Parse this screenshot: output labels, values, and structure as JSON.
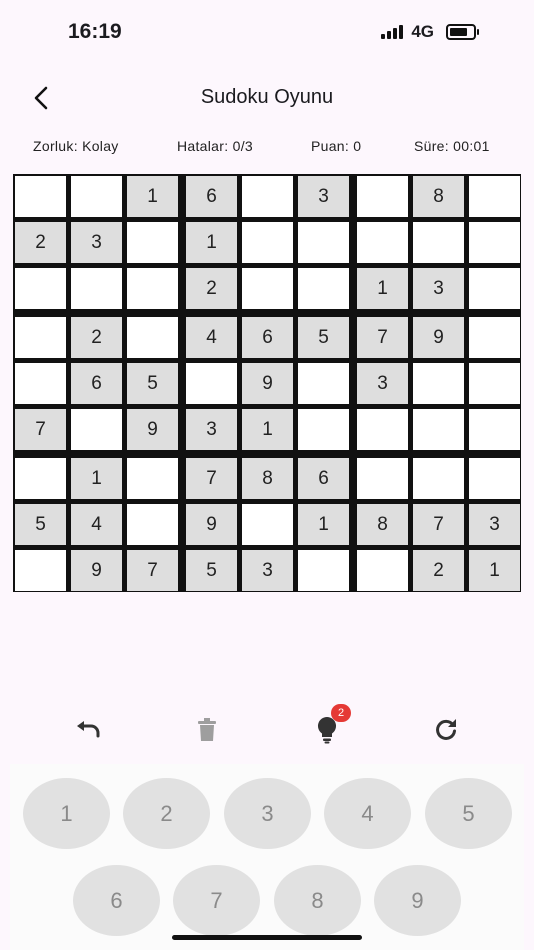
{
  "status_bar": {
    "time": "16:19",
    "network": "4G",
    "battery_level": 0.85
  },
  "header": {
    "title": "Sudoku Oyunu",
    "back_icon": "chevron-left-icon"
  },
  "info": {
    "difficulty": "Zorluk: Kolay",
    "mistakes": "Hatalar: 0/3",
    "score": "Puan: 0",
    "time": "Süre: 00:01"
  },
  "board": {
    "grid": [
      [
        "",
        "",
        "1",
        "6",
        "",
        "3",
        "",
        "8",
        ""
      ],
      [
        "2",
        "3",
        "",
        "1",
        "",
        "",
        "",
        "",
        ""
      ],
      [
        "",
        "",
        "",
        "2",
        "",
        "",
        "1",
        "3",
        ""
      ],
      [
        "",
        "2",
        "",
        "4",
        "6",
        "5",
        "7",
        "9",
        ""
      ],
      [
        "",
        "6",
        "5",
        "",
        "9",
        "",
        "3",
        "",
        ""
      ],
      [
        "7",
        "",
        "9",
        "3",
        "1",
        "",
        "",
        "",
        ""
      ],
      [
        "",
        "1",
        "",
        "7",
        "8",
        "6",
        "",
        "",
        ""
      ],
      [
        "5",
        "4",
        "",
        "9",
        "",
        "1",
        "8",
        "7",
        "3"
      ],
      [
        "",
        "9",
        "7",
        "5",
        "3",
        "",
        "",
        "2",
        "1"
      ]
    ],
    "given_color": "#dedede",
    "empty_color": "#ffffff"
  },
  "tools": {
    "undo_icon": "undo-icon",
    "erase_icon": "trash-icon",
    "hint_icon": "lightbulb-icon",
    "hint_count": "2",
    "restart_icon": "refresh-icon",
    "badge_color": "#e53935"
  },
  "keypad": {
    "keys": [
      "1",
      "2",
      "3",
      "4",
      "5",
      "6",
      "7",
      "8",
      "9"
    ]
  }
}
